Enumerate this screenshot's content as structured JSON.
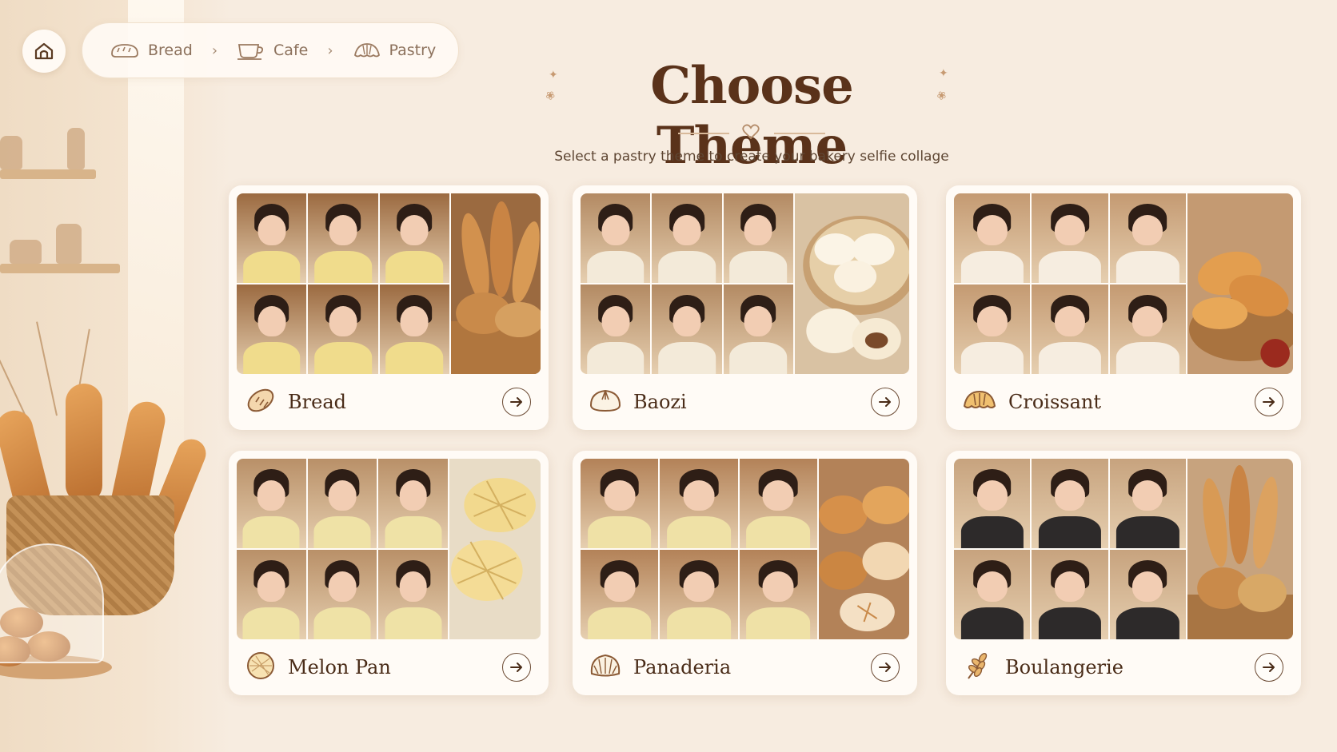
{
  "breadcrumb": {
    "items": [
      {
        "label": "Bread",
        "icon": "bread-loaf-icon"
      },
      {
        "label": "Cafe",
        "icon": "coffee-cup-icon"
      },
      {
        "label": "Pastry",
        "icon": "croissant-icon"
      }
    ],
    "separator": "›"
  },
  "header": {
    "title": "Choose Theme",
    "subtitle": "Select a pastry theme to create your bakery selfie collage"
  },
  "themes": [
    {
      "name": "Bread",
      "icon": "bread-icon",
      "outfit_color": "#f0dc8c",
      "food_color": "#c98a4a",
      "bg_color": "#9b6a40"
    },
    {
      "name": "Baozi",
      "icon": "bao-icon",
      "outfit_color": "#f3ead9",
      "food_color": "#f5ecd8",
      "bg_color": "#b38a63"
    },
    {
      "name": "Croissant",
      "icon": "croissant-icon",
      "outfit_color": "#f6ede0",
      "food_color": "#d9954a",
      "bg_color": "#c49a72"
    },
    {
      "name": "Melon Pan",
      "icon": "melon-pan-icon",
      "outfit_color": "#efe2a6",
      "food_color": "#f2d98e",
      "bg_color": "#b99068"
    },
    {
      "name": "Panaderia",
      "icon": "concha-icon",
      "outfit_color": "#efe1a6",
      "food_color": "#cf8a48",
      "bg_color": "#b38258"
    },
    {
      "name": "Boulangerie",
      "icon": "wheat-icon",
      "outfit_color": "#2d2a2a",
      "food_color": "#c98a4a",
      "bg_color": "#c7a37e"
    }
  ],
  "colors": {
    "background": "#f7ece0",
    "title": "#5a321a",
    "accent": "#c79a72"
  }
}
